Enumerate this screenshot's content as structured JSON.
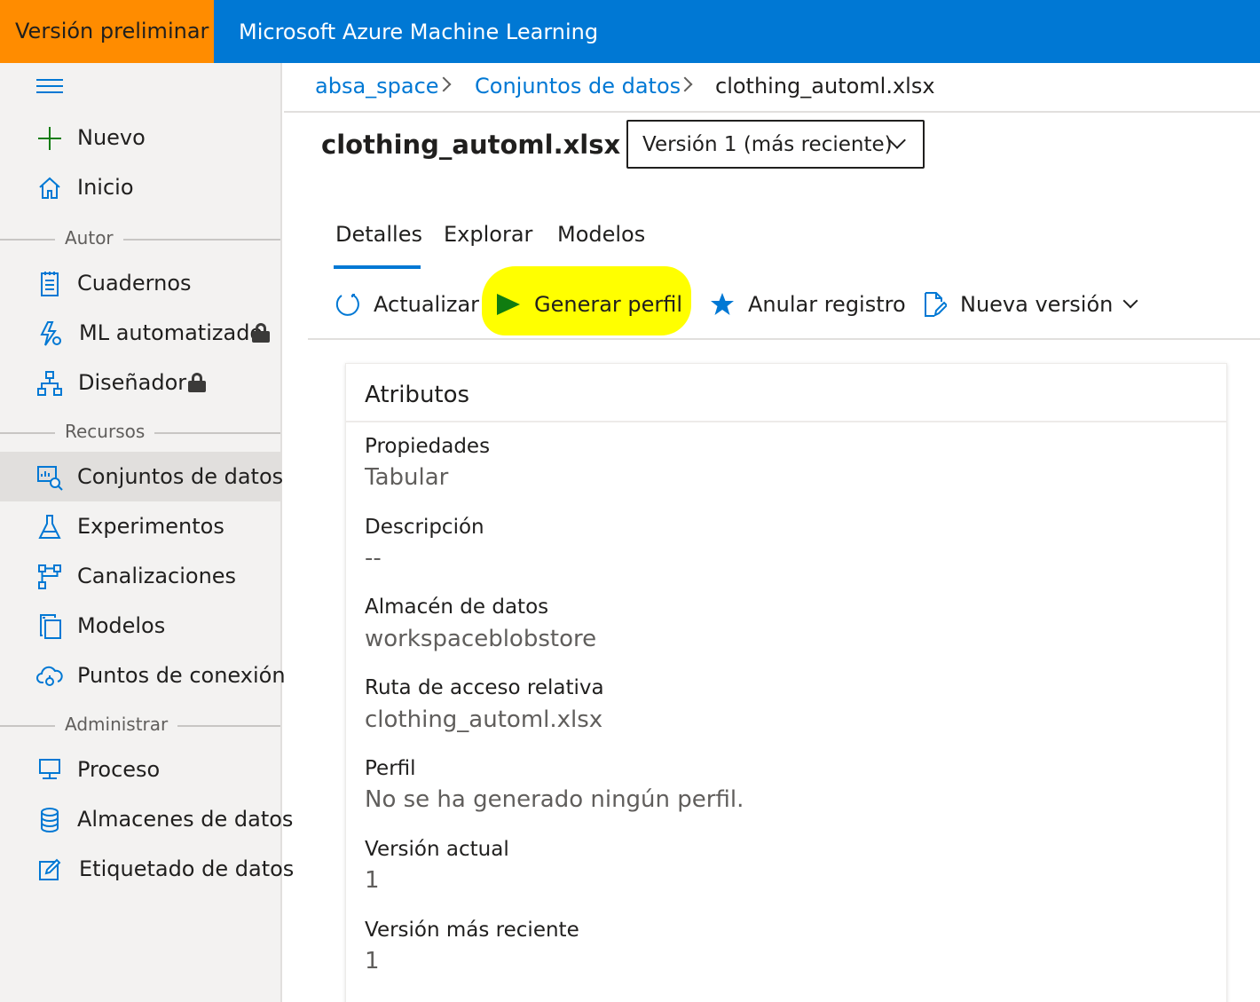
{
  "header": {
    "preview_badge": "Versión preliminar",
    "app_title": "Microsoft Azure Machine Learning"
  },
  "sidebar": {
    "items": [
      {
        "label": "Nuevo",
        "icon": "plus-icon"
      },
      {
        "label": "Inicio",
        "icon": "home-icon"
      },
      {
        "label": "Cuadernos",
        "icon": "notebook-icon"
      },
      {
        "label": "ML automatizado",
        "icon": "automl-icon",
        "locked": true
      },
      {
        "label": "Diseñador",
        "icon": "designer-icon",
        "locked": true
      },
      {
        "label": "Conjuntos de datos",
        "icon": "datasets-icon",
        "active": true
      },
      {
        "label": "Experimentos",
        "icon": "flask-icon"
      },
      {
        "label": "Canalizaciones",
        "icon": "pipeline-icon"
      },
      {
        "label": "Modelos",
        "icon": "models-icon"
      },
      {
        "label": "Puntos de conexión",
        "icon": "endpoint-icon"
      },
      {
        "label": "Proceso",
        "icon": "compute-icon"
      },
      {
        "label": "Almacenes de datos",
        "icon": "datastore-icon"
      },
      {
        "label": "Etiquetado de datos",
        "icon": "labeling-icon"
      }
    ],
    "sections": {
      "author": "Autor",
      "assets": "Recursos",
      "manage": "Administrar"
    }
  },
  "breadcrumb": {
    "workspace": "absa_space",
    "datasets": "Conjuntos de datos",
    "current": "clothing_automl.xlsx"
  },
  "page": {
    "title": "clothing_automl.xlsx",
    "version_selected": "Versión 1 (más reciente)"
  },
  "tabs": [
    "Detalles",
    "Explorar",
    "Modelos"
  ],
  "commands": {
    "refresh": "Actualizar",
    "generate_profile": "Generar perfil",
    "unregister": "Anular registro",
    "new_version": "Nueva versión"
  },
  "attributes": {
    "title": "Atributos",
    "properties_label": "Propiedades",
    "properties_value": "Tabular",
    "description_label": "Descripción",
    "description_value": "--",
    "datastore_label": "Almacén de datos",
    "datastore_value": "workspaceblobstore",
    "relative_path_label": "Ruta de acceso relativa",
    "relative_path_value": "clothing_automl.xlsx",
    "profile_label": "Perfil",
    "profile_value": "No se ha generado ningún perfil.",
    "current_version_label": "Versión actual",
    "current_version_value": "1",
    "latest_version_label": "Versión más reciente",
    "latest_version_value": "1"
  },
  "colors": {
    "accent": "#0078d4",
    "preview": "#ff8c00",
    "highlight": "#ffff00",
    "play": "#107c10"
  }
}
